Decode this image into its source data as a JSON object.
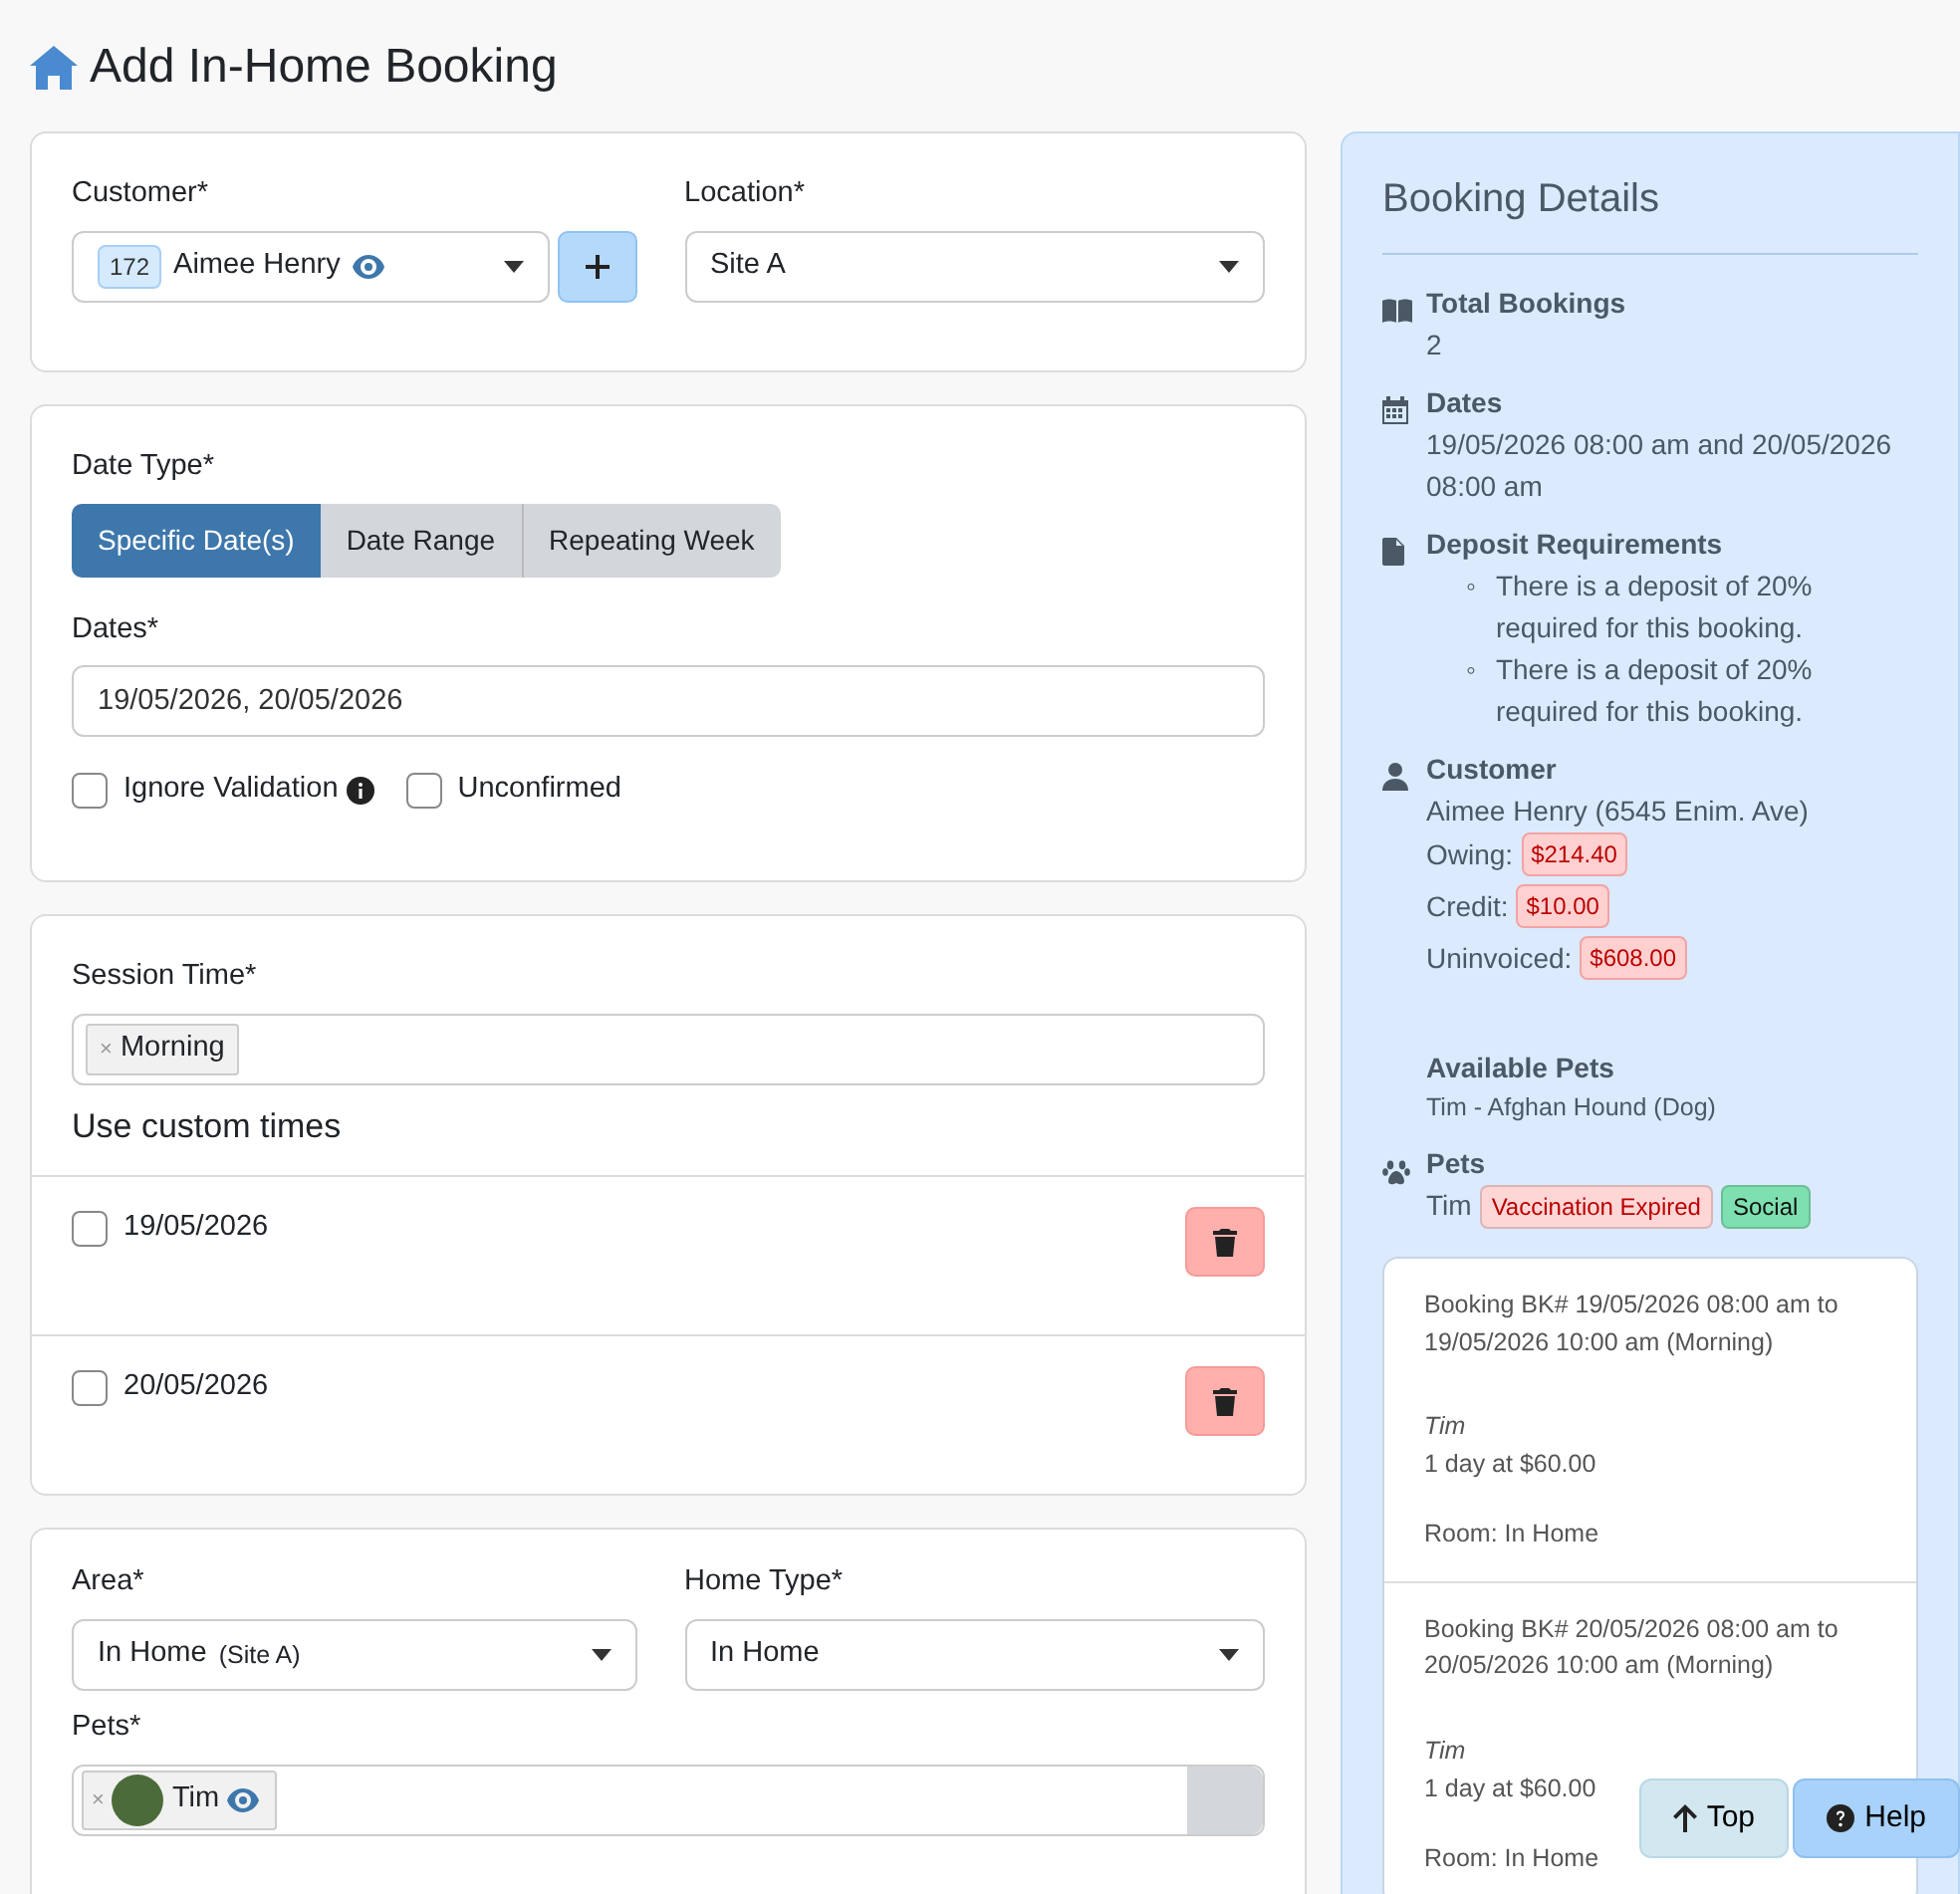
{
  "page": {
    "title": "Add In-Home Booking"
  },
  "customer_card": {
    "customer": {
      "label": "Customer*",
      "id_badge": "172",
      "value": "Aimee Henry"
    },
    "location": {
      "label": "Location*",
      "value": "Site A"
    }
  },
  "date_card": {
    "date_type": {
      "label": "Date Type*",
      "options": [
        {
          "label": "Specific Date(s)",
          "selected": true
        },
        {
          "label": "Date Range",
          "selected": false
        },
        {
          "label": "Repeating Week",
          "selected": false
        }
      ]
    },
    "dates": {
      "label": "Dates*",
      "value": "19/05/2026, 20/05/2026"
    },
    "checkboxes": [
      {
        "label": "Ignore Validation",
        "checked": false
      },
      {
        "label": "Unconfirmed",
        "checked": false
      }
    ]
  },
  "session_card": {
    "label": "Session Time*",
    "tags": [
      {
        "remove": "×",
        "label": "Morning"
      }
    ],
    "custom_title": "Use custom times",
    "custom_dates": [
      {
        "date": "19/05/2026",
        "checked": false
      },
      {
        "date": "20/05/2026",
        "checked": false
      }
    ]
  },
  "area_card": {
    "area": {
      "label": "Area*",
      "value": "In Home",
      "note": "(Site A)"
    },
    "home_type": {
      "label": "Home Type*",
      "value": "In Home"
    },
    "pets": {
      "label": "Pets*",
      "chips": [
        {
          "remove": "×",
          "label": "Tim"
        }
      ]
    }
  },
  "details": {
    "title": "Booking Details",
    "sections": [
      {
        "kind": "value",
        "title": "Total Bookings",
        "text": "2"
      },
      {
        "kind": "value",
        "title": "Dates",
        "text": "19/05/2026 08:00 am and 20/05/2026 08:00 am"
      },
      {
        "kind": "list",
        "title": "Deposit Requirements",
        "marker": "◦",
        "items": [
          "There is a deposit of 20% required for this booking.",
          "There is a deposit of 20% required for this booking."
        ]
      },
      {
        "kind": "customer",
        "title": "Customer",
        "text": "Aimee Henry (6545 Enim. Ave)",
        "amounts": [
          {
            "label": "Owing:",
            "amount": "$214.40"
          },
          {
            "label": "Credit:",
            "amount": "$10.00"
          },
          {
            "label": "Uninvoiced:",
            "amount": "$608.00"
          }
        ]
      },
      {
        "kind": "small",
        "title": "Available Pets",
        "text": "Tim - Afghan Hound (Dog)"
      },
      {
        "kind": "tags",
        "title": "Pets",
        "text": "Tim",
        "tags": [
          {
            "label": "Vaccination Expired",
            "color": "#ffd6d6"
          },
          {
            "label": "Social",
            "color": "#7ee0b0"
          }
        ]
      }
    ]
  },
  "bookings": [
    {
      "heading": "Booking BK# 19/05/2026 08:00 am to 19/05/2026 10:00 am (Morning)",
      "pet": "Tim",
      "price": "1 day at $60.00",
      "room": "Room: In Home"
    },
    {
      "heading": "Booking BK# 20/05/2026 08:00 am to 20/05/2026 10:00 am (Morning)",
      "pet": "Tim",
      "price": "1 day at $60.00",
      "room": "Room: In Home"
    }
  ],
  "floating_buttons": [
    {
      "kind": "top",
      "label": "Top"
    },
    {
      "kind": "help",
      "label": "Help"
    }
  ]
}
